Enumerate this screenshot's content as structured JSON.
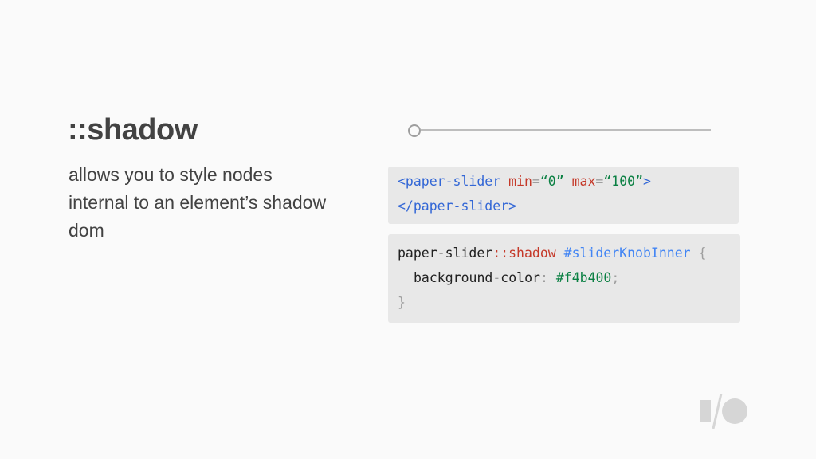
{
  "slide": {
    "title": "::shadow",
    "description": "allows you to style nodes internal to an element’s shadow dom"
  },
  "slider": {
    "value": 0,
    "min": 0,
    "max": 100
  },
  "code_html": {
    "line1": {
      "open": "<paper-slider",
      "attr1": "min",
      "eq1": "=",
      "val1": "“0”",
      "attr2": "max",
      "eq2": "=",
      "val2": "“100”",
      "close": ">"
    },
    "line2": "</paper-slider>"
  },
  "code_css": {
    "line1": {
      "selector_a": "paper",
      "dash": "-",
      "selector_b": "slider",
      "pseudo": "::shadow",
      "id": "#sliderKnobInner",
      "brace_open": "{"
    },
    "line2": {
      "prop_a": "background",
      "dash": "-",
      "prop_b": "color",
      "colon": ":",
      "value": "#f4b400",
      "semi": ";"
    },
    "line3": "}"
  },
  "logo": {
    "icon": "google-io-logo-icon",
    "color": "#d6d6d6"
  }
}
